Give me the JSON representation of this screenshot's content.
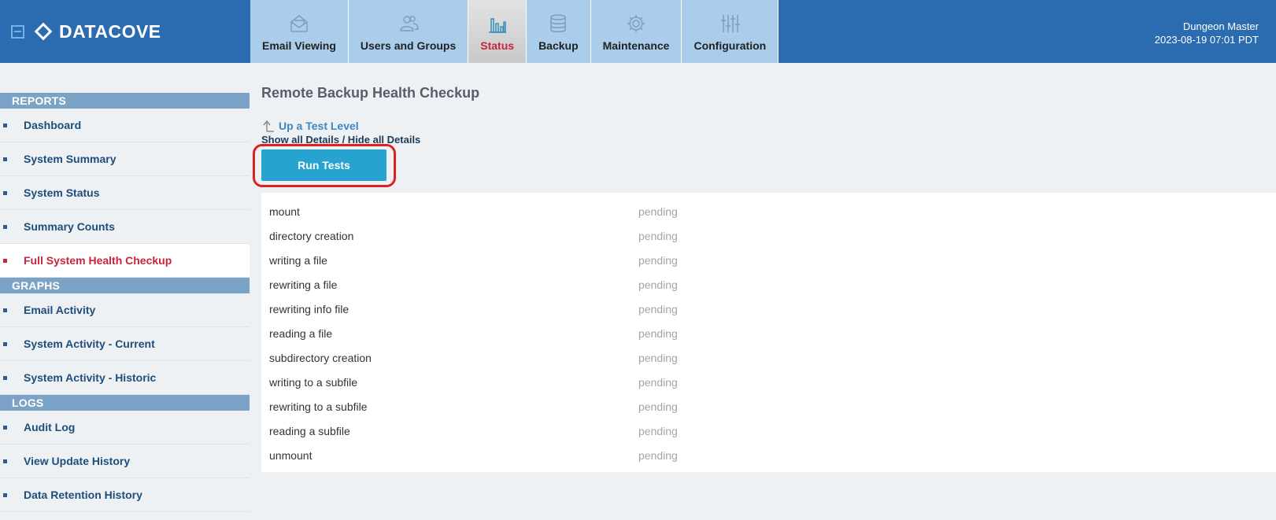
{
  "header": {
    "brand": "DATACOVE",
    "user_name": "Dungeon Master",
    "datetime": "2023-08-19 07:01 PDT",
    "colors": {
      "bar": "#2b6cb0",
      "tab": "#a9cdea",
      "active_text": "#c8243c"
    }
  },
  "tabs": [
    {
      "label": "Email Viewing",
      "icon": "envelope-icon"
    },
    {
      "label": "Users and Groups",
      "icon": "users-icon"
    },
    {
      "label": "Status",
      "icon": "bar-chart-icon",
      "active": true
    },
    {
      "label": "Backup",
      "icon": "database-icon"
    },
    {
      "label": "Maintenance",
      "icon": "gear-icon"
    },
    {
      "label": "Configuration",
      "icon": "sliders-icon"
    }
  ],
  "sidebar": {
    "reports": {
      "title": "REPORTS",
      "items": [
        "Dashboard",
        "System Summary",
        "System Status",
        "Summary Counts",
        "Full System Health Checkup"
      ]
    },
    "graphs": {
      "title": "GRAPHS",
      "items": [
        "Email Activity",
        "System Activity - Current",
        "System Activity - Historic"
      ]
    },
    "logs": {
      "title": "LOGS",
      "items": [
        "Audit Log",
        "View Update History",
        "Data Retention History"
      ]
    }
  },
  "main": {
    "title": "Remote Backup Health Checkup",
    "up_link": "Up a Test Level",
    "toggle_details": "Show all Details / Hide all Details",
    "run_button": "Run Tests",
    "tests": [
      {
        "name": "mount",
        "status": "pending"
      },
      {
        "name": "directory creation",
        "status": "pending"
      },
      {
        "name": "writing a file",
        "status": "pending"
      },
      {
        "name": "rewriting a file",
        "status": "pending"
      },
      {
        "name": "rewriting info file",
        "status": "pending"
      },
      {
        "name": "reading a file",
        "status": "pending"
      },
      {
        "name": "subdirectory creation",
        "status": "pending"
      },
      {
        "name": "writing to a subfile",
        "status": "pending"
      },
      {
        "name": "rewriting to a subfile",
        "status": "pending"
      },
      {
        "name": "reading a subfile",
        "status": "pending"
      },
      {
        "name": "unmount",
        "status": "pending"
      }
    ]
  }
}
